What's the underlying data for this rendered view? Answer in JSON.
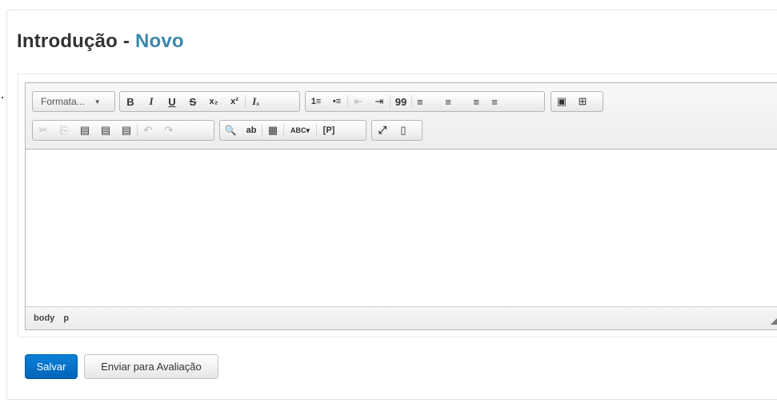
{
  "page": {
    "title": "Introdução",
    "title_separator": "-",
    "title_accent": "Novo"
  },
  "editor": {
    "format_combo": "Formata...",
    "toolbar_row1": [
      {
        "name": "bold-button",
        "glyph": "B"
      },
      {
        "name": "italic-button",
        "glyph": "I"
      },
      {
        "name": "underline-button",
        "glyph": "U"
      },
      {
        "name": "strikethrough-button",
        "glyph": "S"
      },
      {
        "name": "subscript-button",
        "glyph": "x₂"
      },
      {
        "name": "superscript-button",
        "glyph": "x²"
      },
      {
        "name": "remove-format-button",
        "glyph": "Iₓ"
      },
      {
        "name": "numbered-list-button",
        "glyph": "1≡"
      },
      {
        "name": "bulleted-list-button",
        "glyph": "•≡"
      },
      {
        "name": "decrease-indent-button",
        "glyph": "⇤"
      },
      {
        "name": "increase-indent-button",
        "glyph": "⇥"
      },
      {
        "name": "blockquote-button",
        "glyph": "99"
      },
      {
        "name": "align-left-button",
        "glyph": "≡"
      },
      {
        "name": "align-center-button",
        "glyph": "≡"
      },
      {
        "name": "align-right-button",
        "glyph": "≡"
      },
      {
        "name": "justify-button",
        "glyph": "≡"
      },
      {
        "name": "image-button",
        "glyph": "▣"
      },
      {
        "name": "table-button",
        "glyph": "⊞"
      }
    ],
    "toolbar_row2": [
      {
        "name": "cut-button",
        "glyph": "✂"
      },
      {
        "name": "copy-button",
        "glyph": "⎘"
      },
      {
        "name": "paste-button",
        "glyph": "▤"
      },
      {
        "name": "paste-text-button",
        "glyph": "▤"
      },
      {
        "name": "paste-word-button",
        "glyph": "▤"
      },
      {
        "name": "undo-button",
        "glyph": "↶"
      },
      {
        "name": "redo-button",
        "glyph": "↷"
      },
      {
        "name": "find-button",
        "glyph": "🔍"
      },
      {
        "name": "replace-button",
        "glyph": "ab"
      },
      {
        "name": "select-all-button",
        "glyph": "▦"
      },
      {
        "name": "spellcheck-button",
        "glyph": "ABC▾"
      },
      {
        "name": "show-blocks-button",
        "glyph": "[P]"
      },
      {
        "name": "maximize-button",
        "glyph": "⤢"
      },
      {
        "name": "source-button",
        "glyph": "▯"
      }
    ],
    "status_path": [
      "body",
      "p"
    ]
  },
  "actions": {
    "save_label": "Salvar",
    "send_label": "Enviar para Avaliação"
  },
  "colors": {
    "accent": "#3a87ad",
    "primary_button": "#0a73c9"
  }
}
